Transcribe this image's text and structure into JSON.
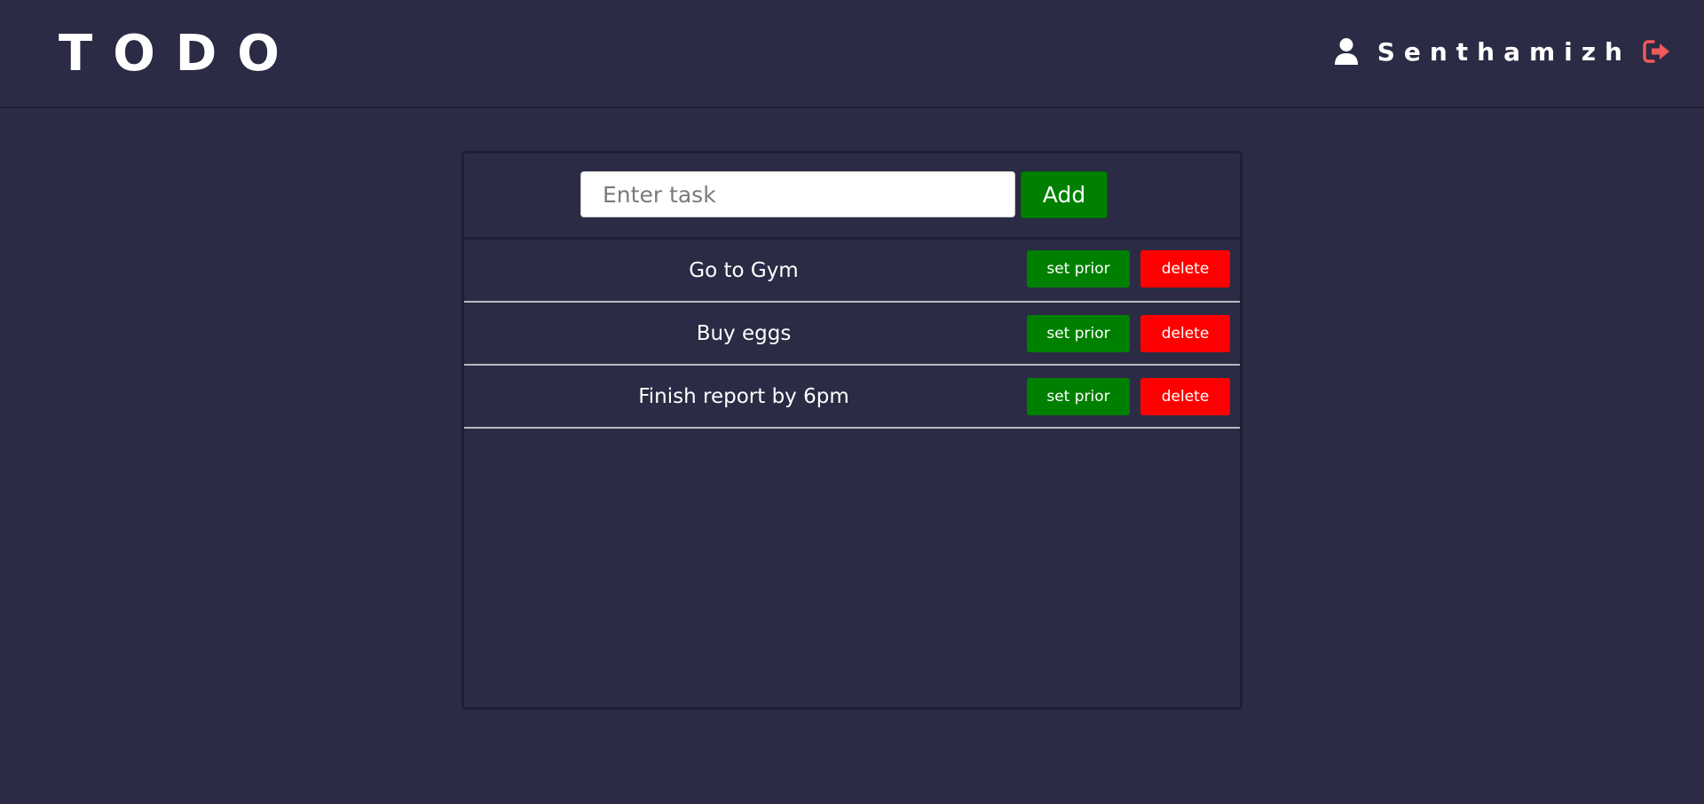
{
  "header": {
    "brand": "TODO",
    "user_name": "Senthamizh",
    "user_icon": "user-icon",
    "logout_icon": "sign-out-icon",
    "logout_color": "#f05a5a"
  },
  "task_form": {
    "placeholder": "Enter task",
    "value": "",
    "add_label": "Add"
  },
  "tasks": [
    {
      "text": "Go to Gym",
      "prior_label": "set prior",
      "delete_label": "delete"
    },
    {
      "text": "Buy eggs",
      "prior_label": "set prior",
      "delete_label": "delete"
    },
    {
      "text": "Finish report by 6pm",
      "prior_label": "set prior",
      "delete_label": "delete"
    }
  ],
  "colors": {
    "background": "#2b2b45",
    "prior_button": "#008000",
    "delete_button": "#ff0000"
  }
}
